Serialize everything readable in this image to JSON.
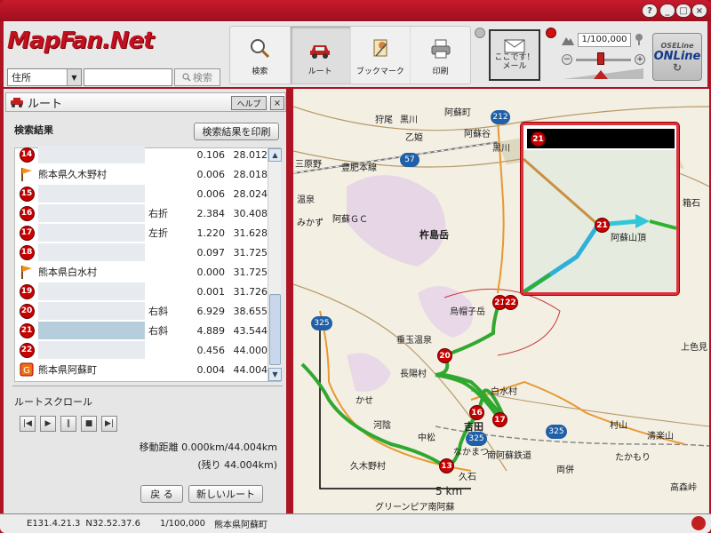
{
  "window": {
    "title_controls": [
      "?",
      "_",
      "□",
      "×"
    ]
  },
  "logo": {
    "text": "MapFan.Net"
  },
  "search": {
    "category": "住所",
    "input_value": "",
    "button": "検索"
  },
  "toolbar": {
    "items": [
      {
        "label": "検索",
        "icon": "magnifier-icon"
      },
      {
        "label": "ルート",
        "icon": "car-icon"
      },
      {
        "label": "ブックマーク",
        "icon": "bookmark-icon"
      },
      {
        "label": "印刷",
        "icon": "printer-icon"
      }
    ],
    "mail_line1": "ここです！",
    "mail_line2": "メール"
  },
  "scale": {
    "value": "1/100,000"
  },
  "online": {
    "line1": "OSELine",
    "line2": "ONLine"
  },
  "panel": {
    "title": "ルート",
    "help": "ヘルプ",
    "close": "×",
    "results_title": "検索結果",
    "print_button": "検索結果を印刷",
    "rows": [
      {
        "icon": "14",
        "type": "badge",
        "name": "",
        "turn": "",
        "d1": "0.106",
        "d2": "28.012"
      },
      {
        "icon": "flag",
        "type": "flag",
        "name": "熊本県久木野村",
        "turn": "",
        "d1": "0.006",
        "d2": "28.018"
      },
      {
        "icon": "15",
        "type": "badge",
        "name": "",
        "turn": "",
        "d1": "0.006",
        "d2": "28.024"
      },
      {
        "icon": "16",
        "type": "badge",
        "name": "",
        "turn": "右折",
        "d1": "2.384",
        "d2": "30.408"
      },
      {
        "icon": "17",
        "type": "badge",
        "name": "",
        "turn": "左折",
        "d1": "1.220",
        "d2": "31.628"
      },
      {
        "icon": "18",
        "type": "badge",
        "name": "",
        "turn": "",
        "d1": "0.097",
        "d2": "31.725"
      },
      {
        "icon": "flag",
        "type": "flag",
        "name": "熊本県白水村",
        "turn": "",
        "d1": "0.000",
        "d2": "31.725"
      },
      {
        "icon": "19",
        "type": "badge",
        "name": "",
        "turn": "",
        "d1": "0.001",
        "d2": "31.726"
      },
      {
        "icon": "20",
        "type": "badge",
        "name": "",
        "turn": "右斜",
        "d1": "6.929",
        "d2": "38.655"
      },
      {
        "icon": "21",
        "type": "badge",
        "name": "",
        "turn": "右斜",
        "d1": "4.889",
        "d2": "43.544"
      },
      {
        "icon": "22",
        "type": "badge",
        "name": "",
        "turn": "",
        "d1": "0.456",
        "d2": "44.000"
      },
      {
        "icon": "goal",
        "type": "goal",
        "name": "熊本県阿蘇町",
        "turn": "",
        "d1": "0.004",
        "d2": "44.004"
      }
    ],
    "scroll_title": "ルートスクロール",
    "distance_line1": "移動距離 0.000km/44.004km",
    "distance_line2": "(残り 44.004km)",
    "back_button": "戻 る",
    "new_route_button": "新しいルート"
  },
  "map": {
    "labels": [
      "狩尾",
      "黒川",
      "阿蘇町",
      "乙姫",
      "阿蘇谷",
      "黒川",
      "豊肥本線",
      "三原野",
      "温泉",
      "阿蘇ＧＣ",
      "みかず",
      "杵島岳",
      "烏帽子岳",
      "垂玉温泉",
      "長陽村",
      "白水村",
      "河陰",
      "吉田",
      "中松",
      "久木野村",
      "南阿蘇鉄道",
      "久石",
      "両併",
      "村山",
      "清楽山",
      "たかもり",
      "高森峠",
      "上色見",
      "箱石",
      "グリーンピア南阿蘇",
      "5 km",
      "阿蘇山頂",
      "かせ",
      "なかまつ"
    ],
    "route_markers": [
      "13",
      "16",
      "17",
      "20",
      "21",
      "22"
    ],
    "road_numbers": [
      "212",
      "57",
      "325",
      "325",
      "325",
      "325"
    ],
    "scale_label": "5 km",
    "inset_marker": "21",
    "inset_label": "阿蘇山頂"
  },
  "status": {
    "lon": "E131.4.21.3",
    "lat": "N32.52.37.6",
    "scale": "1/100,000",
    "place": "熊本県阿蘇町"
  }
}
